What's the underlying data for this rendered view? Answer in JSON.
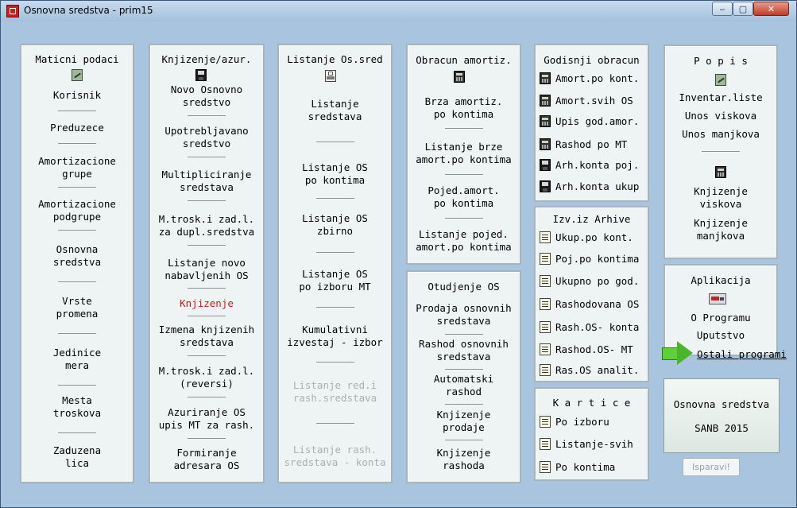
{
  "window": {
    "title": "Osnovna sredstva - prim15",
    "minimize": "‒",
    "maximize": "▢",
    "close": "✕"
  },
  "p1": {
    "title": "Maticni podaci",
    "icon": "pencil-icon",
    "items": [
      "Korisnik",
      "Preduzece",
      "Amortizacione\ngrupe",
      "Amortizacione\npodgrupe",
      "Osnovna\nsredstva",
      "Vrste\npromena",
      "Jedinice\nmera",
      "Mesta\ntroskova",
      "Zaduzena\nlica"
    ]
  },
  "p2": {
    "title": "Knjizenje/azur.",
    "icon": "floppy-icon",
    "items": [
      "Novo Osnovno\nsredstvo",
      "Upotrebljavano\nsredstvo",
      "Multipliciranje\nsredstava",
      "M.trosk.i zad.l.\nza dupl.sredstva",
      "Listanje novo\nnabavljenih OS",
      "Knjizenje",
      "Izmena knjizenih\nsredstava",
      "M.trosk.i zad.l.\n(reversi)",
      "Azuriranje OS\nupis MT za rash.",
      "Formiranje\nadresara OS"
    ]
  },
  "p3": {
    "title": "Listanje Os.sred",
    "icon": "printer-icon",
    "items": [
      "Listanje\nsredstava",
      "Listanje OS\npo kontima",
      "Listanje OS\nzbirno",
      "Listanje OS\npo izboru MT",
      "Kumulativni\nizvestaj - izbor",
      "Listanje red.i\nrash.sredstava",
      "Listanje rash.\nsredstava - konta"
    ]
  },
  "p4": {
    "title": "Obracun amortiz.",
    "icon": "calculator-icon",
    "items": [
      "Brza amortiz.\npo kontima",
      "Listanje brze\namort.po kontima",
      "Pojed.amort.\npo kontima",
      "Listanje pojed.\namort.po kontima"
    ]
  },
  "p5": {
    "title": "Otudjenje OS",
    "items": [
      "Prodaja osnovnih\nsredstava",
      "Rashod osnovnih\nsredstava",
      "Automatski\nrashod",
      "Knjizenje\nprodaje",
      "Knjizenje\nrashoda"
    ]
  },
  "p6": {
    "title": "Godisnji obracun",
    "items": [
      "Amort.po kont.",
      "Amort.svih OS",
      "Upis god.amor.",
      "Rashod po MT",
      "Arh.konta poj.",
      "Arh.konta ukup"
    ]
  },
  "p7": {
    "title": "Izv.iz Arhive",
    "items": [
      "Ukup.po kont.",
      "Poj.po kontima",
      "Ukupno po god.",
      "Rashodovana OS",
      "Rash.OS- konta",
      "Rashod.OS- MT",
      "Ras.OS analit."
    ]
  },
  "p8": {
    "title": "K a r t i c e",
    "items": [
      "Po izboru",
      "Listanje-svih",
      "Po kontima"
    ]
  },
  "p9": {
    "title": "P o p i s",
    "icon": "pencil-icon",
    "items": [
      "Inventar.liste",
      "Unos viskova",
      "Unos manjkova",
      "Knjizenje\nviskova",
      "Knjizenje\nmanjkova"
    ]
  },
  "p10": {
    "title": "Aplikacija",
    "icon": "truck-icon",
    "items": [
      "O Programu",
      "Uputstvo"
    ]
  },
  "ostali": "Ostali programi",
  "info": {
    "line1": "Osnovna sredstva",
    "line2": "SANB 2015"
  },
  "isparavi": "Isparavi!"
}
